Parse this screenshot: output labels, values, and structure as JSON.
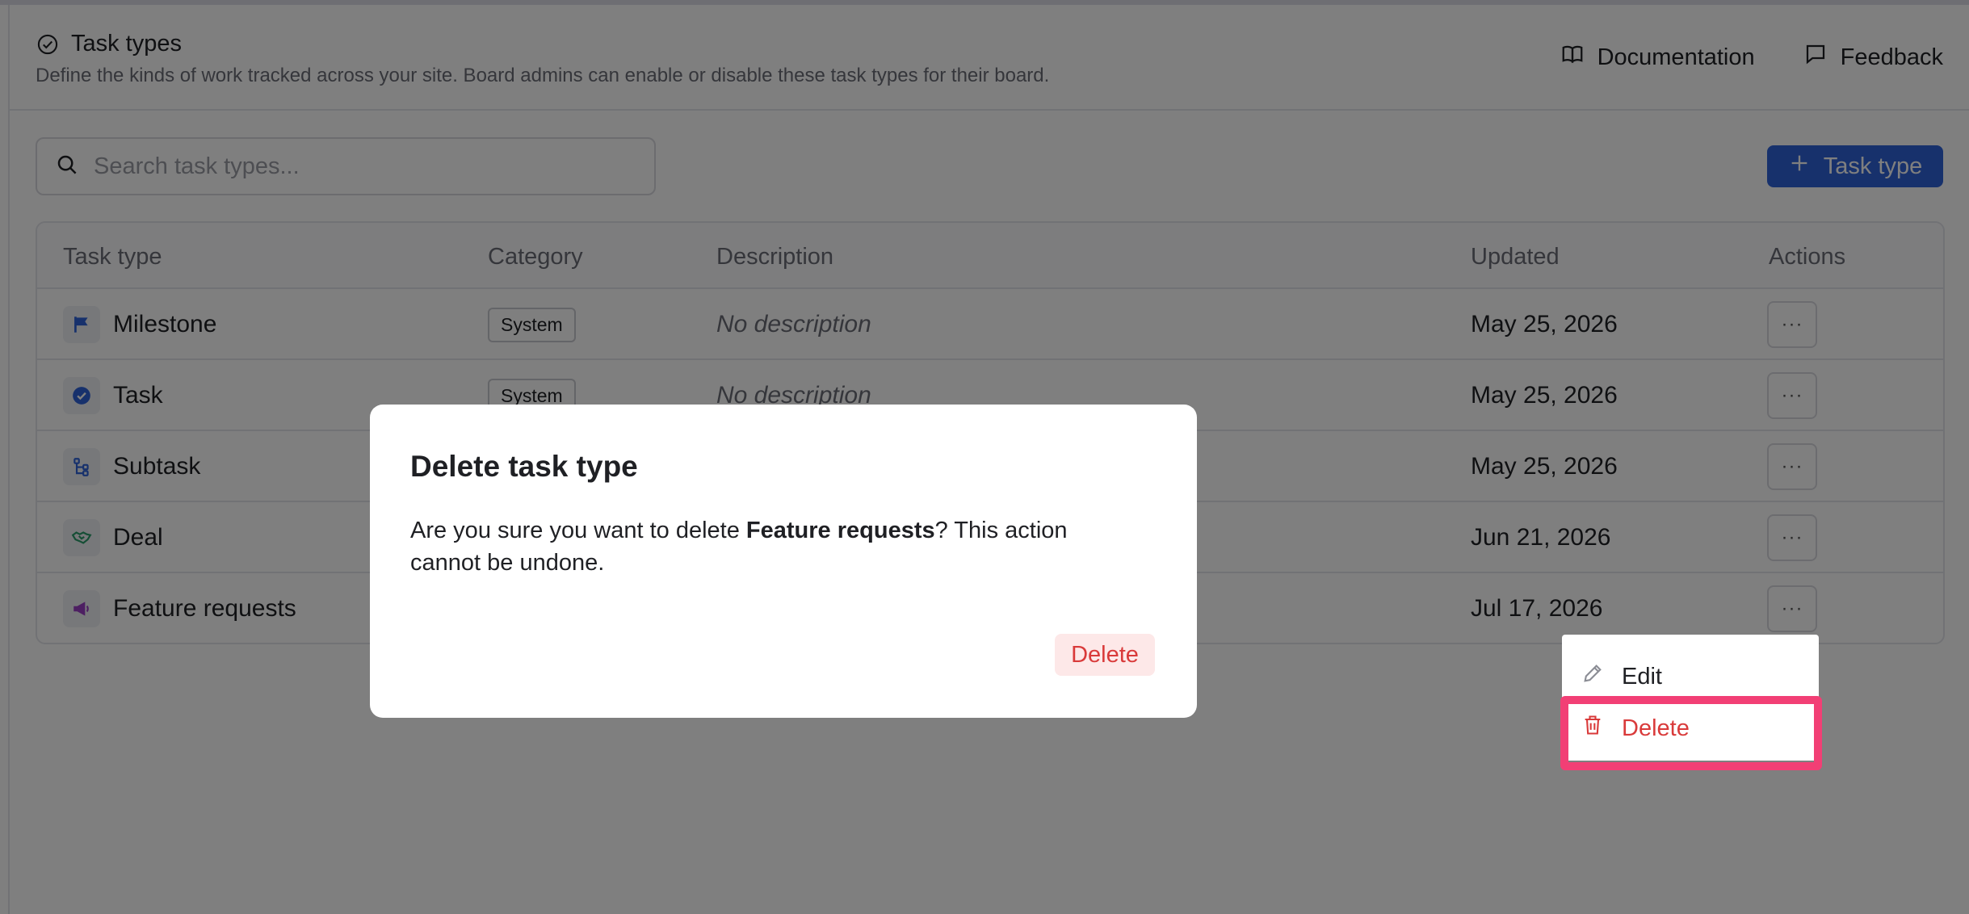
{
  "header": {
    "title": "Task types",
    "subtitle": "Define the kinds of work tracked across your site. Board admins can enable or disable these task types for their board.",
    "links": [
      {
        "label": "Documentation",
        "icon": "book-icon"
      },
      {
        "label": "Feedback",
        "icon": "message-icon"
      }
    ]
  },
  "toolbar": {
    "search_placeholder": "Search task types...",
    "add_label": "Task type"
  },
  "table": {
    "columns": [
      "Task type",
      "Category",
      "Description",
      "Updated",
      "Actions"
    ],
    "rows": [
      {
        "name": "Milestone",
        "icon": "flag-icon",
        "icon_color": "#2f63d9",
        "category": "System",
        "description": "No description",
        "updated": "May 25, 2026"
      },
      {
        "name": "Task",
        "icon": "check-circle-icon",
        "icon_color": "#2f63d9",
        "category": "System",
        "description": "No description",
        "updated": "May 25, 2026"
      },
      {
        "name": "Subtask",
        "icon": "subtask-icon",
        "icon_color": "#2f63d9",
        "category": "",
        "description": "",
        "updated": "May 25, 2026"
      },
      {
        "name": "Deal",
        "icon": "handshake-icon",
        "icon_color": "#2a9d6a",
        "category": "",
        "description": "",
        "updated": "Jun 21, 2026"
      },
      {
        "name": "Feature requests",
        "icon": "megaphone-icon",
        "icon_color": "#9b3fc4",
        "category": "",
        "description": "",
        "updated": "Jul 17, 2026"
      }
    ],
    "actions_glyph": "···"
  },
  "menu": {
    "items": [
      {
        "label": "Edit",
        "icon": "pencil-icon"
      },
      {
        "label": "Delete",
        "icon": "trash-icon",
        "color": "#d93a3a"
      }
    ]
  },
  "dialog": {
    "title": "Delete task type",
    "body_prefix": "Are you sure you want to delete ",
    "body_item": "Feature requests",
    "body_suffix": "? This action cannot be undone.",
    "delete_label": "Delete"
  },
  "colors": {
    "accent": "#2f63d9",
    "danger": "#d93a3a",
    "highlight": "#f23f75"
  }
}
